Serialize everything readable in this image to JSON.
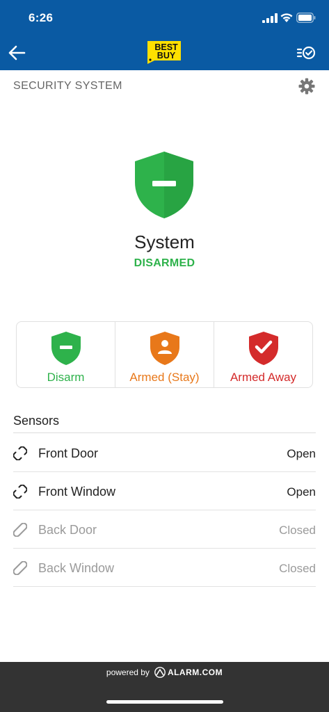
{
  "status_bar": {
    "time": "6:26"
  },
  "header": {
    "brand": "BEST BUY",
    "section_title": "SECURITY SYSTEM"
  },
  "system": {
    "name": "System",
    "state": "DISARMED",
    "state_color": "#2eb24b"
  },
  "arming": [
    {
      "label": "Disarm",
      "icon": "shield-minus-icon",
      "color": "#2eb24b"
    },
    {
      "label": "Armed (Stay)",
      "icon": "shield-person-icon",
      "color": "#e8781a"
    },
    {
      "label": "Armed Away",
      "icon": "shield-check-icon",
      "color": "#d42b2b"
    }
  ],
  "sensors": {
    "title": "Sensors",
    "items": [
      {
        "name": "Front Door",
        "state": "Open"
      },
      {
        "name": "Front Window",
        "state": "Open"
      },
      {
        "name": "Back Door",
        "state": "Closed"
      },
      {
        "name": "Back Window",
        "state": "Closed"
      }
    ]
  },
  "footer": {
    "powered_by": "powered by",
    "provider": "ALARM.COM"
  },
  "colors": {
    "header_blue": "#0a5aa3",
    "brand_yellow": "#ffe000",
    "footer_bg": "#333333"
  }
}
